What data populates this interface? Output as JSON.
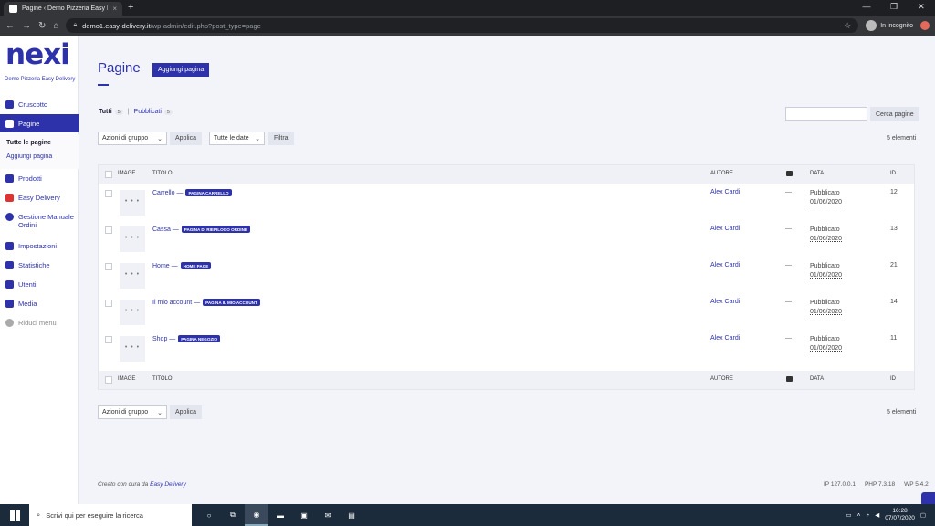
{
  "browser": {
    "tab_title": "Pagine ‹ Demo Pizzeria Easy Deli…",
    "tab_close": "×",
    "new_tab": "+",
    "url_host": "demo1.easy-delivery.it",
    "url_path": "/wp-admin/edit.php?post_type=page",
    "incognito_label": "In incognito"
  },
  "sidebar": {
    "logo": "nexi",
    "site_name": "Demo Pizzeria Easy Delivery",
    "items": [
      {
        "label": "Cruscotto"
      },
      {
        "label": "Pagine"
      },
      {
        "label": "Prodotti"
      },
      {
        "label": "Easy Delivery"
      },
      {
        "label": "Gestione Manuale Ordini"
      },
      {
        "label": "Impostazioni"
      },
      {
        "label": "Statistiche"
      },
      {
        "label": "Utenti"
      },
      {
        "label": "Media"
      },
      {
        "label": "Riduci menu"
      }
    ],
    "subitems": [
      {
        "label": "Tutte le pagine"
      },
      {
        "label": "Aggiungi pagina"
      }
    ]
  },
  "header": {
    "title": "Pagine",
    "add_button": "Aggiungi pagina"
  },
  "filters": {
    "all_label": "Tutti",
    "all_count": "5",
    "separator": "|",
    "published_label": "Pubblicati",
    "published_count": "5",
    "search_button": "Cerca pagine",
    "bulk_action": "Azioni di gruppo",
    "apply": "Applica",
    "dates": "Tutte le date",
    "filter": "Filtra",
    "count_text": "5 elementi"
  },
  "table": {
    "columns": {
      "image": "IMAGE",
      "title": "TITOLO",
      "author": "AUTORE",
      "date": "DATA",
      "id": "ID"
    },
    "rows": [
      {
        "thumb": "• • •",
        "title": "Carrello —",
        "badge": "Pagina carrello",
        "author": "Alex Cardi",
        "comments": "—",
        "status": "Pubblicato",
        "date": "01/06/2020",
        "id": "12"
      },
      {
        "thumb": "• • •",
        "title": "Cassa —",
        "badge": "Pagina di riepilogo ordine",
        "author": "Alex Cardi",
        "comments": "—",
        "status": "Pubblicato",
        "date": "01/06/2020",
        "id": "13"
      },
      {
        "thumb": "• • •",
        "title": "Home —",
        "badge": "Home page",
        "author": "Alex Cardi",
        "comments": "—",
        "status": "Pubblicato",
        "date": "01/06/2020",
        "id": "21"
      },
      {
        "thumb": "• • •",
        "title": "Il mio account —",
        "badge": "Pagina il mio account",
        "author": "Alex Cardi",
        "comments": "—",
        "status": "Pubblicato",
        "date": "01/06/2020",
        "id": "14"
      },
      {
        "thumb": "• • •",
        "title": "Shop —",
        "badge": "Pagina negozio",
        "author": "Alex Cardi",
        "comments": "—",
        "status": "Pubblicato",
        "date": "01/06/2020",
        "id": "11"
      }
    ]
  },
  "footer": {
    "credit_prefix": "Creato con cura da",
    "credit_link": "Easy Delivery",
    "ip": "IP 127.0.0.1",
    "php": "PHP 7.3.18",
    "wp": "WP 5.4.2"
  },
  "taskbar": {
    "search_placeholder": "Scrivi qui per eseguire la ricerca",
    "time": "16:28",
    "date": "07/07/2020"
  },
  "colors": {
    "accent": "#2d32aa",
    "taskbar": "#1c2b3b"
  }
}
